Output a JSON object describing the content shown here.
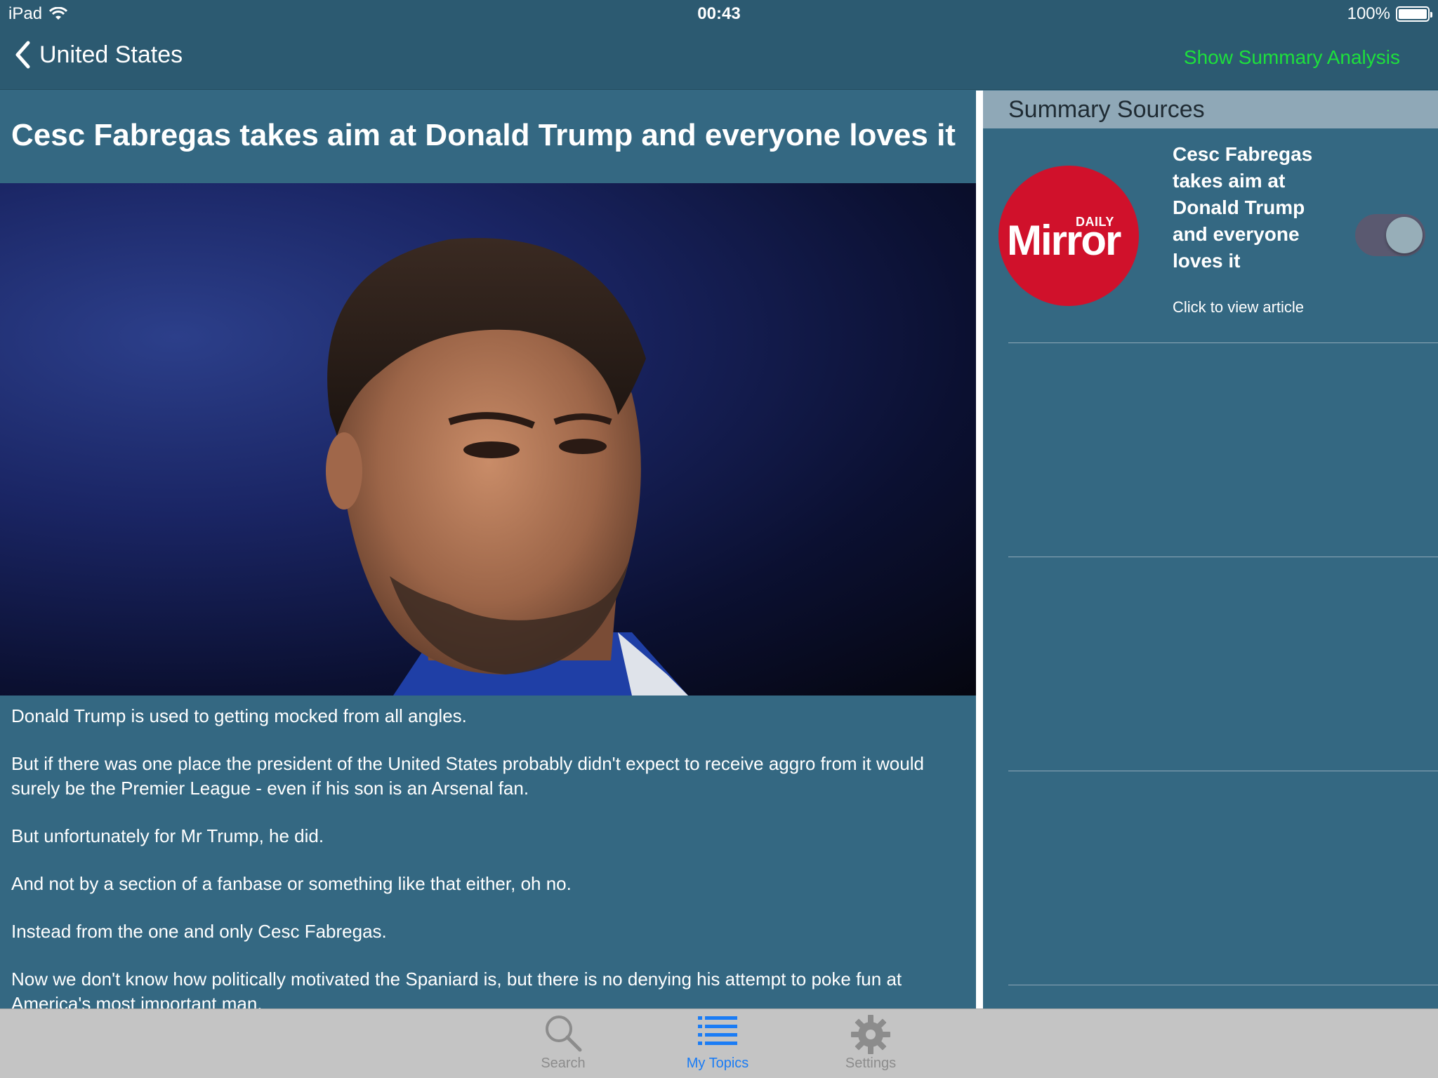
{
  "status_bar": {
    "device": "iPad",
    "time": "00:43",
    "battery": "100%"
  },
  "nav": {
    "back_label": "United States",
    "summary_link": "Show Summary Analysis"
  },
  "article": {
    "title": "Cesc Fabregas takes aim at Donald Trump and everyone loves it",
    "paragraphs": [
      "Donald Trump is used to getting mocked from all angles.",
      "But if there was one place the president of the United States probably didn't expect to receive aggro from it would surely be the Premier League - even if his son is an Arsenal fan.",
      "But unfortunately for Mr Trump, he did.",
      "And not by a section of a fanbase or something like that either, oh no.",
      "Instead from the one and only Cesc Fabregas.",
      "Now we don't know how politically motivated the Spaniard is, but there is no denying his attempt to poke fun at America's most important man."
    ]
  },
  "sources": {
    "header": "Summary Sources",
    "items": [
      {
        "logo_small": "DAILY",
        "logo_main": "Mirror",
        "title": "Cesc Fabregas takes aim at Donald Trump and everyone loves it",
        "cta": "Click to view article",
        "toggle_on": true
      }
    ]
  },
  "tabs": [
    {
      "label": "Search",
      "icon": "search-icon",
      "active": false
    },
    {
      "label": "My Topics",
      "icon": "list-icon",
      "active": true
    },
    {
      "label": "Settings",
      "icon": "gear-icon",
      "active": false
    }
  ],
  "colors": {
    "background": "#346882",
    "nav_bar": "#2c5a71",
    "summary_link": "#1de03c",
    "sources_header": "#8fa8b7",
    "logo_red": "#d0112b",
    "tab_active": "#1a7cf5",
    "tab_inactive": "#8c8c8c"
  }
}
